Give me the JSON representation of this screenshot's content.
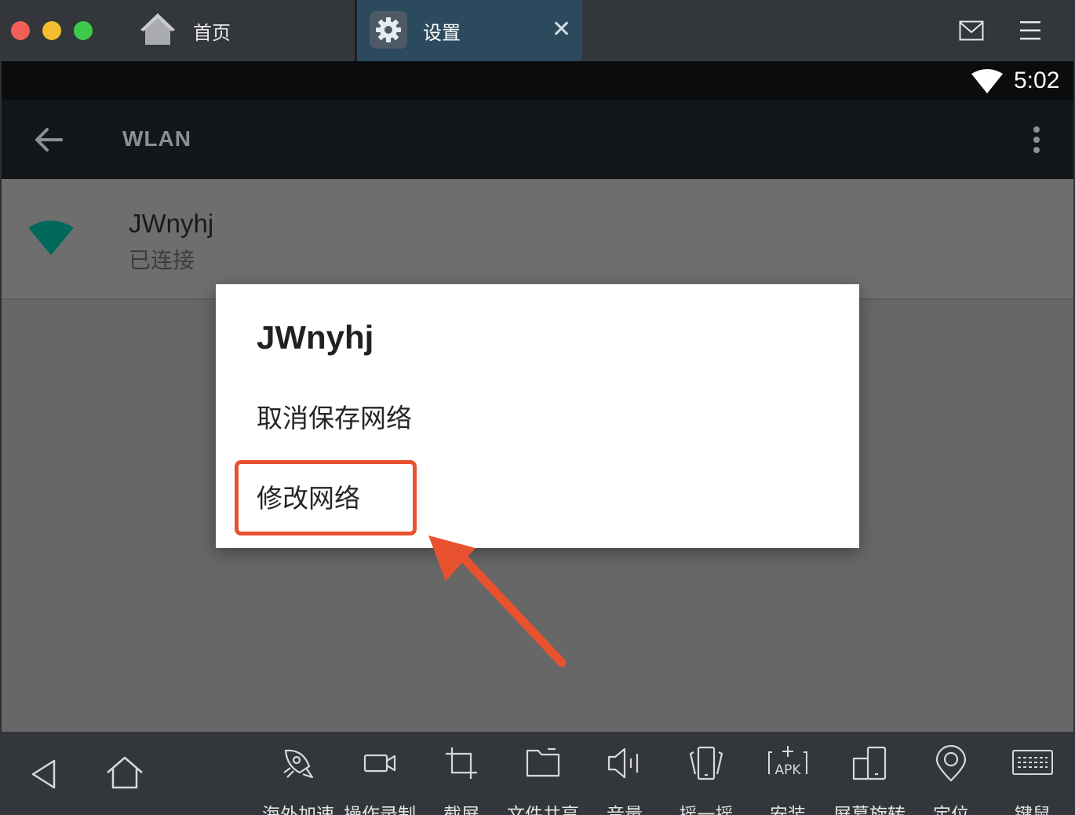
{
  "titlebar": {
    "tabs": [
      {
        "label": "首页",
        "icon": "home-icon"
      },
      {
        "label": "设置",
        "icon": "gear-icon",
        "close": "✕"
      }
    ]
  },
  "statusbar": {
    "time": "5:02"
  },
  "actionbar": {
    "title": "WLAN"
  },
  "network": {
    "name": "JWnyhj",
    "status": "已连接"
  },
  "dialog": {
    "title": "JWnyhj",
    "items": [
      "取消保存网络",
      "修改网络"
    ]
  },
  "toolbar": {
    "items": [
      {
        "label": "海外加速",
        "icon": "rocket-icon"
      },
      {
        "label": "操作录制",
        "icon": "video-camera-icon"
      },
      {
        "label": "截屏",
        "icon": "crop-icon"
      },
      {
        "label": "文件共享",
        "icon": "folder-icon"
      },
      {
        "label": "音量",
        "icon": "speaker-icon"
      },
      {
        "label": "摇一摇",
        "icon": "shake-phone-icon"
      },
      {
        "label": "安装",
        "icon": "apk-install-icon"
      },
      {
        "label": "屏幕旋转",
        "icon": "rotate-screen-icon"
      },
      {
        "label": "定位",
        "icon": "location-pin-icon"
      },
      {
        "label": "键鼠",
        "icon": "keyboard-icon"
      }
    ]
  },
  "colors": {
    "highlight": "#e8522f",
    "wifi_signal": "#00695c",
    "active_tab": "#2c4a5e"
  }
}
